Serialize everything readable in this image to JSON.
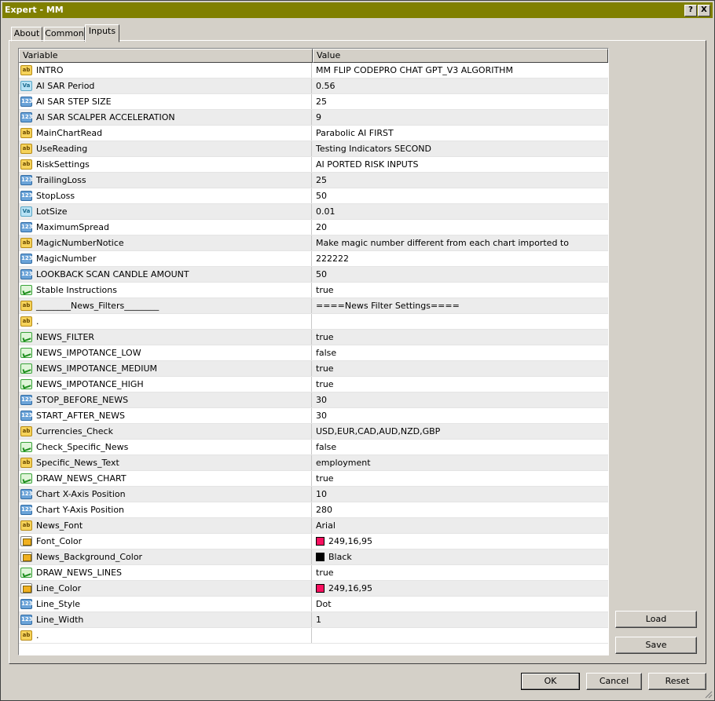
{
  "window": {
    "title": "Expert - MM",
    "help_button": "?",
    "close_button": "X"
  },
  "tabs": [
    {
      "label": "About"
    },
    {
      "label": "Common"
    },
    {
      "label": "Inputs"
    }
  ],
  "grid": {
    "col_variable": "Variable",
    "col_value": "Value",
    "rows": [
      {
        "icon": "ab",
        "name": "INTRO",
        "value": "MM FLIP CODEPRO CHAT GPT_V3 ALGORITHM"
      },
      {
        "icon": "dbl",
        "name": "AI SAR Period",
        "value": "0.56"
      },
      {
        "icon": "num",
        "name": "AI SAR STEP SIZE",
        "value": "25"
      },
      {
        "icon": "num",
        "name": "AI SAR SCALPER ACCELERATION",
        "value": "9"
      },
      {
        "icon": "ab",
        "name": "MainChartRead",
        "value": "Parabolic AI FIRST"
      },
      {
        "icon": "ab",
        "name": "UseReading",
        "value": "Testing Indicators SECOND"
      },
      {
        "icon": "ab",
        "name": "RiskSettings",
        "value": "AI PORTED RISK INPUTS"
      },
      {
        "icon": "num",
        "name": "TrailingLoss",
        "value": "25"
      },
      {
        "icon": "num",
        "name": "StopLoss",
        "value": "50"
      },
      {
        "icon": "dbl",
        "name": "LotSize",
        "value": "0.01"
      },
      {
        "icon": "num",
        "name": "MaximumSpread",
        "value": "20"
      },
      {
        "icon": "ab",
        "name": "MagicNumberNotice",
        "value": "Make magic number different from each chart imported to"
      },
      {
        "icon": "num",
        "name": "MagicNumber",
        "value": "222222"
      },
      {
        "icon": "num",
        "name": "LOOKBACK SCAN CANDLE AMOUNT",
        "value": "50"
      },
      {
        "icon": "bool",
        "name": "Stable Instructions",
        "value": "true"
      },
      {
        "icon": "ab",
        "name": "________News_Filters________",
        "value": "====News Filter Settings===="
      },
      {
        "icon": "ab",
        "name": ".",
        "value": ""
      },
      {
        "icon": "bool",
        "name": "NEWS_FILTER",
        "value": "true"
      },
      {
        "icon": "bool",
        "name": "NEWS_IMPOTANCE_LOW",
        "value": "false"
      },
      {
        "icon": "bool",
        "name": "NEWS_IMPOTANCE_MEDIUM",
        "value": "true"
      },
      {
        "icon": "bool",
        "name": "NEWS_IMPOTANCE_HIGH",
        "value": "true"
      },
      {
        "icon": "num",
        "name": "STOP_BEFORE_NEWS",
        "value": "30"
      },
      {
        "icon": "num",
        "name": "START_AFTER_NEWS",
        "value": "30"
      },
      {
        "icon": "ab",
        "name": "Currencies_Check",
        "value": "USD,EUR,CAD,AUD,NZD,GBP"
      },
      {
        "icon": "bool",
        "name": "Check_Specific_News",
        "value": "false"
      },
      {
        "icon": "ab",
        "name": "Specific_News_Text",
        "value": "employment"
      },
      {
        "icon": "bool",
        "name": "DRAW_NEWS_CHART",
        "value": "true"
      },
      {
        "icon": "num",
        "name": "Chart X-Axis Position",
        "value": "10"
      },
      {
        "icon": "num",
        "name": "Chart Y-Axis Position",
        "value": "280"
      },
      {
        "icon": "ab",
        "name": "News_Font",
        "value": "Arial"
      },
      {
        "icon": "clr",
        "name": "Font_Color",
        "value": "249,16,95",
        "swatch": "#f9105f"
      },
      {
        "icon": "clr",
        "name": "News_Background_Color",
        "value": "Black",
        "swatch": "#000000"
      },
      {
        "icon": "bool",
        "name": "DRAW_NEWS_LINES",
        "value": "true"
      },
      {
        "icon": "clr",
        "name": "Line_Color",
        "value": "249,16,95",
        "swatch": "#f9105f"
      },
      {
        "icon": "num",
        "name": "Line_Style",
        "value": "Dot"
      },
      {
        "icon": "num",
        "name": "Line_Width",
        "value": "1"
      },
      {
        "icon": "ab",
        "name": ".",
        "value": ""
      }
    ]
  },
  "side_buttons": {
    "load": "Load",
    "save": "Save"
  },
  "footer_buttons": {
    "ok": "OK",
    "cancel": "Cancel",
    "reset": "Reset"
  },
  "colors": {
    "titlebar": "#808000",
    "dialog": "#d4d0c8"
  }
}
